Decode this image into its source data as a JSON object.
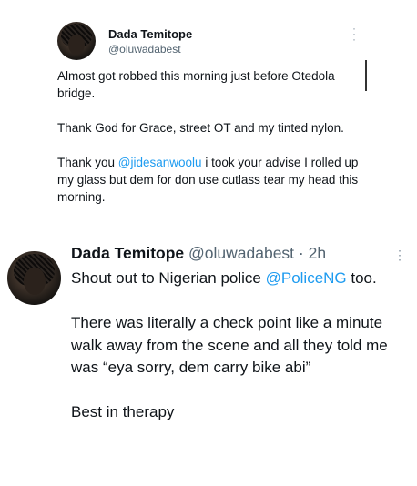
{
  "quoted_tweet": {
    "author_name": "Dada Temitope",
    "author_handle": "@oluwadabest",
    "line1": "Almost got robbed this morning just before Otedola bridge.",
    "line2": "Thank God for Grace, street OT and my tinted nylon.",
    "line3_prefix": "Thank you ",
    "line3_mention": "@jidesanwoolu",
    "line3_suffix": " i took your advise I rolled up my glass but dem for don use cutlass tear my head this morning."
  },
  "reply_tweet": {
    "author_name": "Dada Temitope",
    "author_handle": "@oluwadabest",
    "separator": " · ",
    "time": "2h",
    "para1_prefix": "Shout out to Nigerian police ",
    "para1_mention": "@PoliceNG",
    "para1_suffix": " too.",
    "para2": "There was literally a check point like a minute walk away from the scene and all they told me was “eya sorry, dem carry bike abi”",
    "para3": "Best in therapy"
  },
  "icons": {
    "more": "more-options-icon"
  },
  "colors": {
    "mention": "#1d9bf0",
    "text": "#0f1419",
    "secondary": "#536471"
  }
}
